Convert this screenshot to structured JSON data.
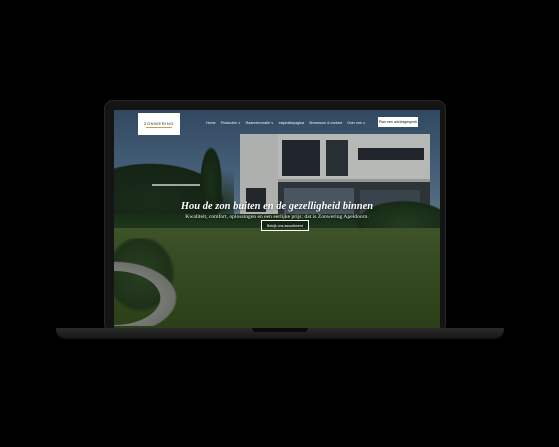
{
  "site": {
    "logo_text": "ZONWERING",
    "nav": {
      "items": [
        "Home",
        "Producten ∨",
        "Raamdecoratie ∨",
        "Inspiratiepagina",
        "Showroom & contact",
        "Over ons ∨"
      ],
      "cta": "Plan een adviesgesprek"
    },
    "hero": {
      "title": "Hou de zon buiten en de gezelligheid binnen",
      "subtitle": "Kwaliteit, comfort, oplossingen en een eerlijke prijs: dat is Zonwering Apeldoorn.",
      "button": "Bekijk ons assortiment"
    }
  },
  "colors": {
    "accent": "#c79a5b",
    "device_frame": "#141414",
    "background": "#000000"
  }
}
